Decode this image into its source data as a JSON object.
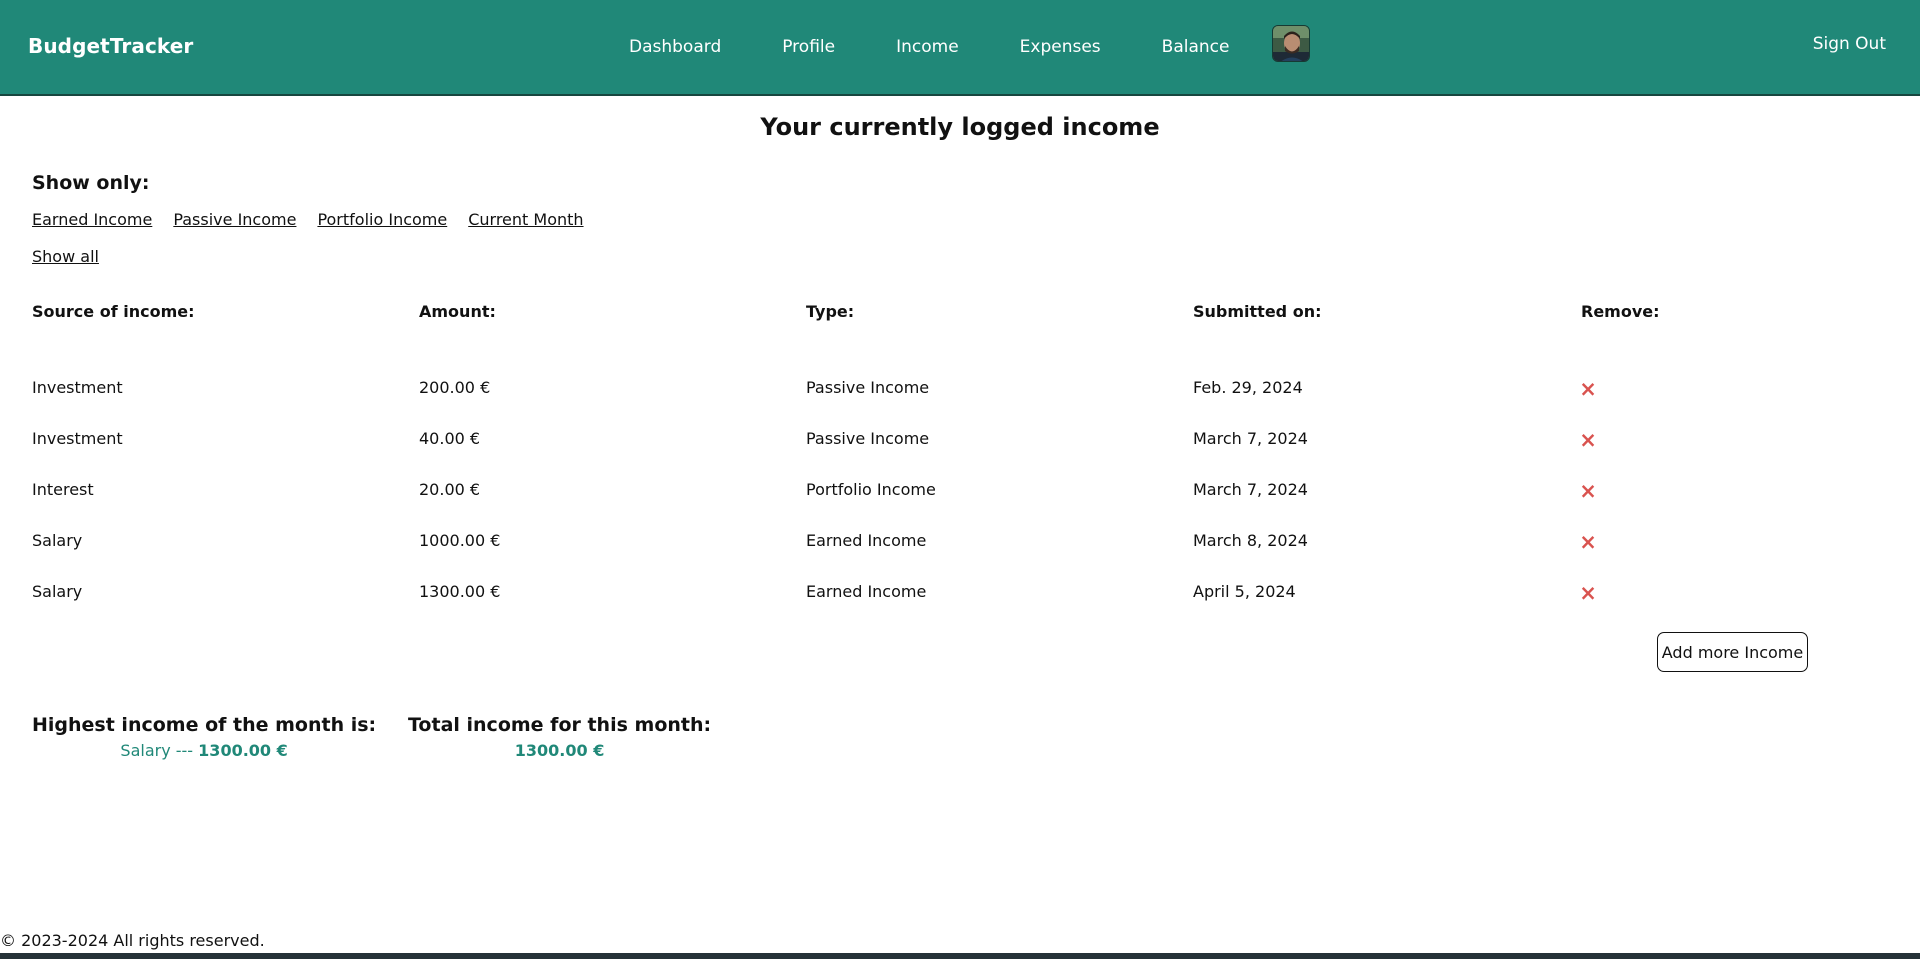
{
  "header": {
    "brand": "BudgetTracker",
    "nav": [
      {
        "label": "Dashboard"
      },
      {
        "label": "Profile"
      },
      {
        "label": "Income"
      },
      {
        "label": "Expenses"
      },
      {
        "label": "Balance"
      }
    ],
    "sign_out": "Sign Out",
    "colors": {
      "navbar": "#208878",
      "accent_text": "#208878",
      "remove": "#d9534f"
    }
  },
  "page": {
    "title": "Your currently logged income",
    "filters": {
      "heading": "Show only:",
      "options": [
        "Earned Income",
        "Passive Income",
        "Portfolio Income",
        "Current Month"
      ],
      "show_all": "Show all"
    }
  },
  "table": {
    "headers": [
      "Source of income:",
      "Amount:",
      "Type:",
      "Submitted on:",
      "Remove:"
    ],
    "rows": [
      {
        "source": "Investment",
        "amount": "200.00 €",
        "type": "Passive Income",
        "date": "Feb. 29, 2024"
      },
      {
        "source": "Investment",
        "amount": "40.00 €",
        "type": "Passive Income",
        "date": "March 7, 2024"
      },
      {
        "source": "Interest",
        "amount": "20.00 €",
        "type": "Portfolio Income",
        "date": "March 7, 2024"
      },
      {
        "source": "Salary",
        "amount": "1000.00 €",
        "type": "Earned Income",
        "date": "March 8, 2024"
      },
      {
        "source": "Salary",
        "amount": "1300.00 €",
        "type": "Earned Income",
        "date": "April 5, 2024"
      }
    ],
    "remove_icon": "×",
    "add_button": "Add more Income"
  },
  "summary": {
    "highest": {
      "label": "Highest income of the month is:",
      "source": "Salary ---",
      "amount": "1300.00 €"
    },
    "total": {
      "label": "Total income for this month:",
      "amount": "1300.00 €"
    }
  },
  "footer": {
    "text": "© 2023-2024 All rights reserved."
  }
}
